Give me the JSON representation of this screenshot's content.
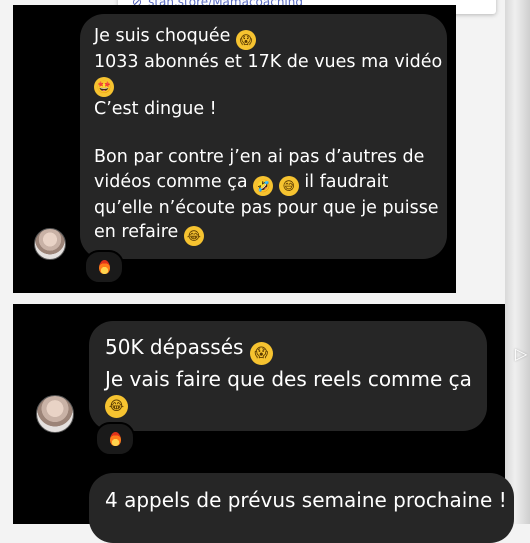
{
  "link_card": {
    "url": "stan.store/Mamacoaching",
    "icon": "link-icon"
  },
  "message1": {
    "lines": [
      "Je suis choquée",
      "1033 abonnés et 17K de vues ma vidéo",
      "C’est dingue !",
      "Bon par contre j’en ai pas d’autres de",
      "vidéos comme ça",
      "il faudrait",
      "qu’elle n’écoute pas pour que je puisse",
      "en refaire"
    ],
    "emojis": [
      "face-screaming-in-fear",
      "star-struck",
      "rolling-on-floor-laughing",
      "grinning-sweat",
      "tears-of-joy"
    ],
    "reaction": "fire"
  },
  "message2": {
    "lines": [
      "50K dépassés",
      "Je vais faire que des reels comme ça"
    ],
    "emojis": [
      "face-screaming-in-fear",
      "tears-of-joy"
    ],
    "reaction": "fire"
  },
  "message3": {
    "lines": [
      "4 appels de prévus semaine prochaine !"
    ]
  },
  "colors": {
    "bubble": "#262626",
    "panel": "#000000",
    "text": "#ffffff",
    "link": "#5a6cc2"
  }
}
